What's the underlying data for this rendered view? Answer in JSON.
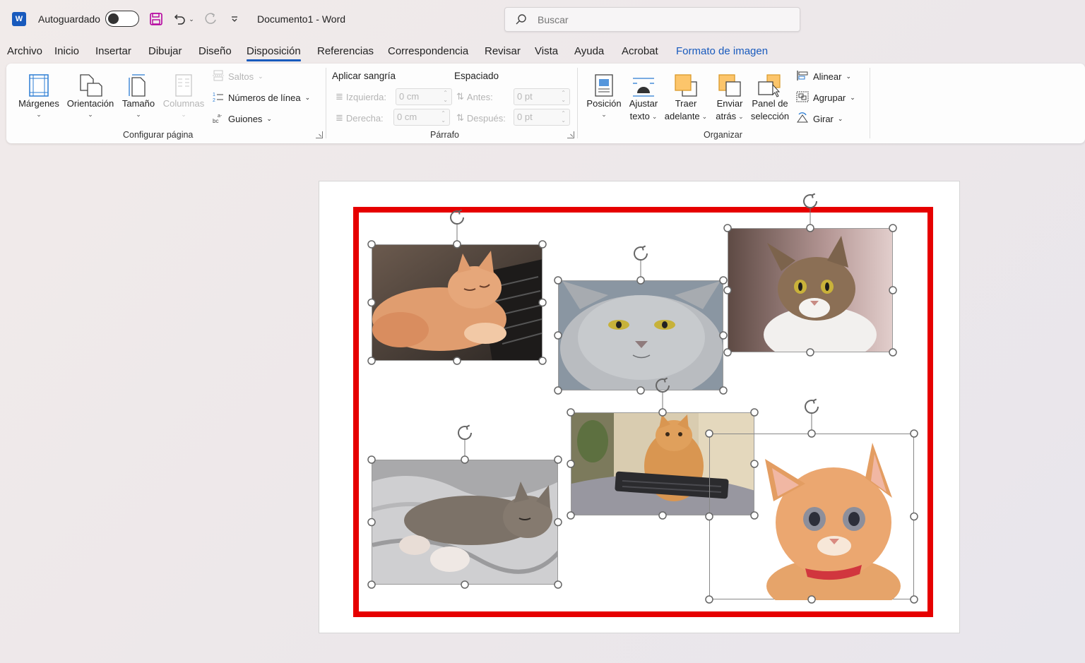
{
  "titlebar": {
    "autosave_label": "Autoguardado",
    "doc_title": "Documento1  -  Word",
    "search_placeholder": "Buscar"
  },
  "tabs": [
    {
      "label": "Archivo"
    },
    {
      "label": "Inicio"
    },
    {
      "label": "Insertar"
    },
    {
      "label": "Dibujar"
    },
    {
      "label": "Diseño"
    },
    {
      "label": "Disposición",
      "active": true
    },
    {
      "label": "Referencias"
    },
    {
      "label": "Correspondencia"
    },
    {
      "label": "Revisar"
    },
    {
      "label": "Vista"
    },
    {
      "label": "Ayuda"
    },
    {
      "label": "Acrobat"
    },
    {
      "label": "Formato de imagen",
      "contextual": true
    }
  ],
  "ribbon": {
    "page_setup": {
      "margins": "Márgenes",
      "orientation": "Orientación",
      "size": "Tamaño",
      "columns": "Columnas",
      "breaks": "Saltos",
      "line_numbers": "Números de línea",
      "hyphenation": "Guiones",
      "group_label": "Configurar página"
    },
    "paragraph": {
      "indent_title": "Aplicar sangría",
      "spacing_title": "Espaciado",
      "left_label": "Izquierda:",
      "left_value": "0 cm",
      "right_label": "Derecha:",
      "right_value": "0 cm",
      "before_label": "Antes:",
      "before_value": "0 pt",
      "after_label": "Después:",
      "after_value": "0 pt",
      "group_label": "Párrafo"
    },
    "arrange": {
      "position": "Posición",
      "wrap_line1": "Ajustar",
      "wrap_line2": "texto",
      "forward_line1": "Traer",
      "forward_line2": "adelante",
      "backward_line1": "Enviar",
      "backward_line2": "atrás",
      "pane_line1": "Panel de",
      "pane_line2": "selección",
      "align": "Alinear",
      "group": "Agrupar",
      "rotate": "Girar",
      "group_label": "Organizar"
    }
  },
  "document": {
    "pictures": [
      {
        "name": "cat-sleeping-keyboard",
        "subject": "orange cat sleeping on keyboard"
      },
      {
        "name": "grumpy-gray-cat",
        "subject": "gray british shorthair cat"
      },
      {
        "name": "tabby-white-cat",
        "subject": "tabby and white cat"
      },
      {
        "name": "tabby-sleeping-blanket",
        "subject": "tabby cat sleeping on gray blanket"
      },
      {
        "name": "orange-cat-sofa",
        "subject": "orange cat on sofa with keyboard"
      },
      {
        "name": "orange-kitten",
        "subject": "orange kitten with red collar"
      }
    ]
  },
  "colors": {
    "accent": "#185abd",
    "frame": "#e60000"
  }
}
